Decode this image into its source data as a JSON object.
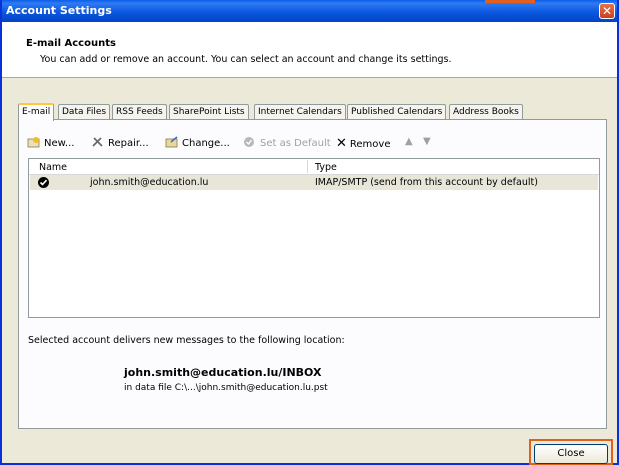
{
  "window": {
    "title": "Account Settings"
  },
  "header": {
    "title": "E-mail Accounts",
    "description": "You can add or remove an account. You can select an account and change its settings."
  },
  "tabs": [
    {
      "label": "E-mail",
      "active": true
    },
    {
      "label": "Data Files"
    },
    {
      "label": "RSS Feeds"
    },
    {
      "label": "SharePoint Lists"
    },
    {
      "label": "Internet Calendars"
    },
    {
      "label": "Published Calendars"
    },
    {
      "label": "Address Books"
    }
  ],
  "toolbar": {
    "new_label": "New...",
    "repair_label": "Repair...",
    "change_label": "Change...",
    "set_default_label": "Set as Default",
    "remove_label": "Remove"
  },
  "list": {
    "columns": [
      "Name",
      "Type"
    ],
    "rows": [
      {
        "name": "john.smith@education.lu",
        "type": "IMAP/SMTP (send from this account by default)"
      }
    ]
  },
  "delivery": {
    "label": "Selected account delivers new messages to the following location:",
    "path": "john.smith@education.lu/INBOX",
    "file": "in data file C:\\...\\john.smith@education.lu.pst"
  },
  "footer": {
    "close_label": "Close"
  },
  "colors": {
    "titlebar": "#0a5ee8",
    "highlight": "#e06020",
    "window_bg": "#ece9d8"
  }
}
